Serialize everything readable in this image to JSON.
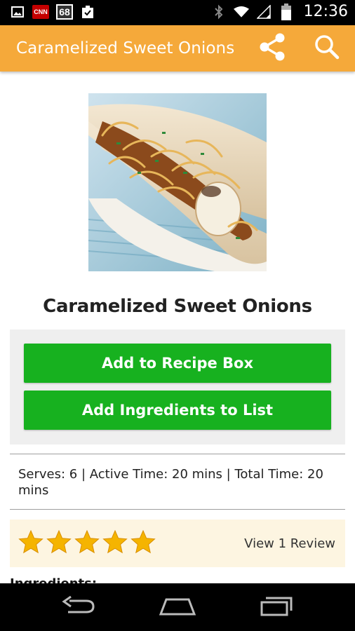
{
  "status_bar": {
    "notif_cnn": "CNN",
    "notif_number": "68",
    "time": "12:36"
  },
  "app_bar": {
    "title": "Caramelized Sweet Onions",
    "icons": [
      "share-icon",
      "search-icon"
    ]
  },
  "recipe": {
    "title": "Caramelized Sweet Onions",
    "image_alt": "hot dog with caramelized onions",
    "info": "Serves: 6 | Active Time: 20 mins | Total Time: 20 mins"
  },
  "actions": {
    "add_recipe_box": "Add to Recipe Box",
    "add_ingredients": "Add Ingredients to List"
  },
  "rating": {
    "stars": 5,
    "max_stars": 5,
    "reviews_link": "View 1 Review"
  },
  "ingredients": {
    "heading": "Ingredients:"
  },
  "colors": {
    "app_bar": "#f5a93a",
    "button_green": "#17b11f",
    "rating_bg": "#fdf5e1",
    "star": "#f5b400"
  }
}
